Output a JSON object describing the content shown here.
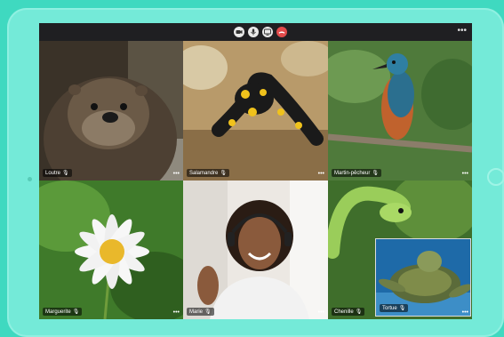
{
  "toolbar": {
    "controls": [
      {
        "icon": "camera-icon"
      },
      {
        "icon": "microphone-icon"
      },
      {
        "icon": "screen-share-icon"
      },
      {
        "icon": "hang-up-icon",
        "color": "#e14b4b"
      }
    ],
    "more": "•••"
  },
  "participants": [
    {
      "name": "Loutre",
      "mic": "🎙",
      "more": "•••"
    },
    {
      "name": "Salamandre",
      "mic": "🎙",
      "more": "•••"
    },
    {
      "name": "Martin-pêcheur",
      "mic": "🎙",
      "more": "•••"
    },
    {
      "name": "Marguerite",
      "mic": "🎙",
      "more": "•••"
    },
    {
      "name": "Marie",
      "mic": "🎙",
      "more": "•••"
    },
    {
      "name": "Chenille",
      "mic": "🎙",
      "more": "•••"
    }
  ],
  "self_view": {
    "name": "Tortue",
    "mic": "🎙"
  }
}
